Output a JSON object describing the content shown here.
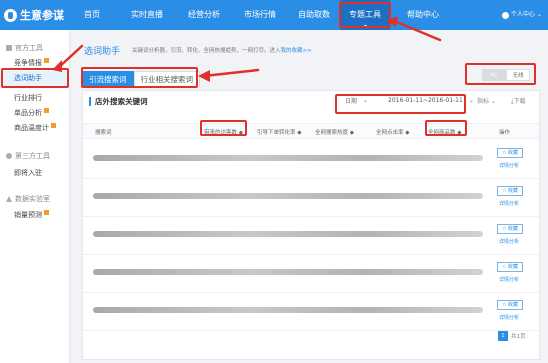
{
  "app": {
    "logo_text": "生意参谋"
  },
  "nav": {
    "items": [
      "首页",
      "实时直播",
      "经营分析",
      "市场行情",
      "自助取数",
      "专题工具",
      "帮助中心"
    ],
    "active_index": 5,
    "user_label": "个人中心"
  },
  "sidebar": {
    "section1": "官方工具",
    "s1_items": [
      "竞争情报",
      "选词助手",
      "行业排行",
      "单品分析",
      "商品温度计"
    ],
    "section2": "第三方工具",
    "s2_items": [
      "即将入驻"
    ],
    "section3": "数据实验室",
    "s3_items": [
      "销量预测"
    ]
  },
  "main": {
    "title": "选词助手",
    "description": "关键词分析器，引流、转化、全网热搜趋势，一网打尽。进入",
    "description_link": "我的收藏>>",
    "tabs": [
      "引流搜索词",
      "行业相关搜索词"
    ],
    "platform": [
      "PC",
      "无线"
    ]
  },
  "panel": {
    "title": "店外搜索关键词",
    "date_label": "日期",
    "date_range": "2016-01-11~2016-01-11",
    "metric_label": "指标",
    "download_label": "下载",
    "columns": [
      "搜索词",
      "带来的访客数 ◆",
      "引导下单转化率 ◆",
      "全网搜索热度 ◆",
      "全网点击率 ◆",
      "全网商品数 ◆",
      "操作"
    ],
    "fav_label": "☆ 收藏",
    "detail_label": "详情分析"
  },
  "pagination": {
    "current": "1",
    "total_text": "共1页"
  },
  "colors": {
    "brand": "#2b8ee6",
    "annotation": "#e0302a"
  }
}
